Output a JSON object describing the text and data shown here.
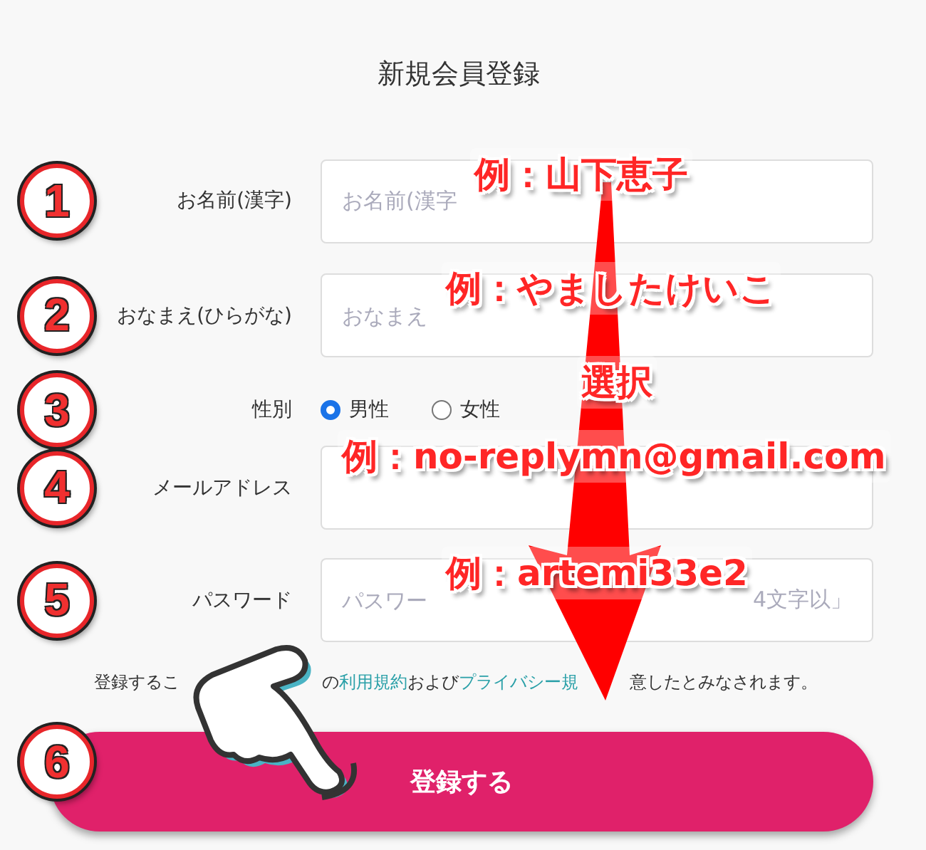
{
  "title": "新規会員登録",
  "rows": [
    {
      "kind": "text",
      "step": "1",
      "label": "お名前(漢字)",
      "placeholder": "お名前(漢字"
    },
    {
      "kind": "text",
      "step": "2",
      "label": "おなまえ(ひらがな)",
      "placeholder": "おなまえ"
    },
    {
      "kind": "radio",
      "step": "3",
      "label": "性別",
      "options": [
        {
          "label": "男性",
          "selected": true
        },
        {
          "label": "女性",
          "selected": false
        }
      ]
    },
    {
      "kind": "text",
      "step": "4",
      "label": "メールアドレス"
    },
    {
      "kind": "text",
      "step": "5",
      "label": "パスワード",
      "placeholder": "パスワー",
      "placeholder_tail": "4文字以」"
    }
  ],
  "terms": [
    {
      "kind": "text",
      "text": "登録するこ"
    },
    {
      "kind": "covered"
    },
    {
      "kind": "text",
      "text": "の"
    },
    {
      "kind": "link",
      "text": "利用規約"
    },
    {
      "kind": "text",
      "text": "および"
    },
    {
      "kind": "link",
      "text": "プライバシー規"
    },
    {
      "kind": "covered"
    },
    {
      "kind": "text",
      "text": "意したとみなされます。"
    }
  ],
  "submit": {
    "step": "6",
    "label": "登録する"
  },
  "annotations": [
    {
      "text": "例：山下恵子"
    },
    {
      "text": "例：やましたけいこ"
    },
    {
      "text": "選択"
    },
    {
      "text": "例：no-replymn@gmail.com"
    },
    {
      "text": "例：artemi33e2"
    }
  ]
}
